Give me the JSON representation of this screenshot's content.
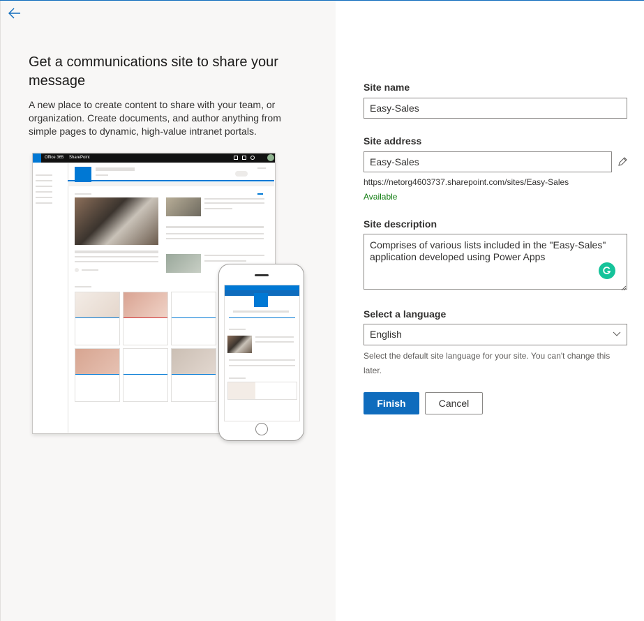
{
  "colors": {
    "accent": "#0f6cbd",
    "available": "#107c10",
    "left_bg": "#f8f7f6"
  },
  "nav": {
    "back_icon": "back-arrow-icon"
  },
  "intro": {
    "title": "Get a communications site to share your message",
    "description": "A new place to create content to share with your team, or organization. Create documents, and author anything from simple pages to dynamic, high-value intranet portals."
  },
  "preview": {
    "suite_name": "Office 365",
    "app_name": "SharePoint"
  },
  "form": {
    "site_name": {
      "label": "Site name",
      "value": "Easy-Sales"
    },
    "site_address": {
      "label": "Site address",
      "value": "Easy-Sales",
      "url": "https://netorg4603737.sharepoint.com/sites/Easy-Sales",
      "status": "Available",
      "edit_icon": "pencil-icon"
    },
    "site_description": {
      "label": "Site description",
      "value": "Comprises of various lists included in the \"Easy-Sales\" application developed using Power Apps",
      "assistant_icon": "grammarly-icon"
    },
    "language": {
      "label": "Select a language",
      "value": "English",
      "help": "Select the default site language for your site. You can't change this later."
    },
    "finish_label": "Finish",
    "cancel_label": "Cancel"
  }
}
